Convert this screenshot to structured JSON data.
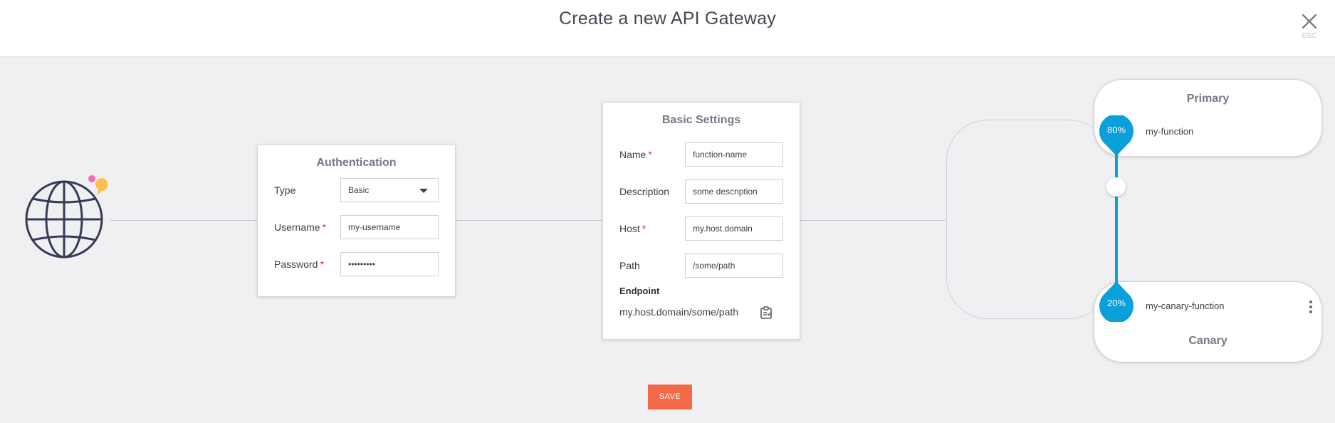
{
  "header": {
    "title": "Create a new API Gateway",
    "close_hint": "ESC"
  },
  "icons": {
    "globe": "globe-icon",
    "close": "close-icon",
    "copy": "copy-to-clipboard-icon",
    "dropdown": "chevron-down-icon",
    "more": "more-vertical-icon"
  },
  "authentication": {
    "title": "Authentication",
    "type_label": "Type",
    "type_value": "Basic",
    "username_label": "Username",
    "username_value": "my-username",
    "password_label": "Password",
    "password_value": "•••••••••",
    "required_mark": "*"
  },
  "basic_settings": {
    "title": "Basic Settings",
    "name_label": "Name",
    "name_value": "function-name",
    "description_label": "Description",
    "description_value": "some description",
    "host_label": "Host",
    "host_value": "my.host.domain",
    "path_label": "Path",
    "path_value": "/some/path",
    "endpoint_title": "Endpoint",
    "endpoint_value": "my.host.domain/some/path",
    "required_mark": "*"
  },
  "routing": {
    "primary": {
      "title": "Primary",
      "function": "my-function",
      "percent_label": "80%",
      "percent": 80
    },
    "canary": {
      "title": "Canary",
      "function": "my-canary-function",
      "percent_label": "20%",
      "percent": 20
    }
  },
  "actions": {
    "save_label": "SAVE"
  },
  "colors": {
    "accent_blue": "#0aa0d9",
    "save_orange": "#f46a47",
    "required_red": "#e0245e",
    "globe_stroke": "#353b56",
    "dot_pink": "#f06ab7",
    "dot_yellow": "#ffc04d"
  }
}
